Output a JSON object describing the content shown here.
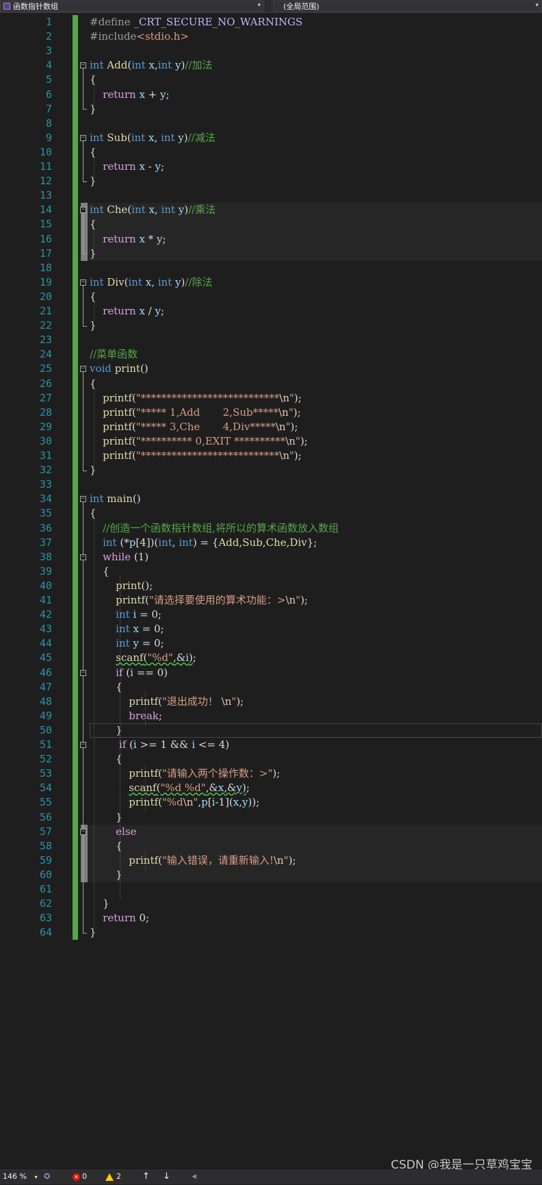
{
  "navbar": {
    "file_scope": "函数指针数组",
    "member_scope": "(全局范围)"
  },
  "colors": {
    "background": "#1e1e1e",
    "line_number": "#2b91af",
    "keyword": "#569cd6",
    "control_keyword": "#d8a0df",
    "string": "#d69d85",
    "comment": "#57a64a",
    "function": "#dcdcaa",
    "change_bar": "#57a64a"
  },
  "editor": {
    "line_numbers": [
      "1",
      "2",
      "3",
      "4",
      "5",
      "6",
      "7",
      "8",
      "9",
      "10",
      "11",
      "12",
      "13",
      "14",
      "15",
      "16",
      "17",
      "18",
      "19",
      "20",
      "21",
      "22",
      "23",
      "24",
      "25",
      "26",
      "27",
      "28",
      "29",
      "30",
      "31",
      "32",
      "33",
      "34",
      "35",
      "36",
      "37",
      "38",
      "39",
      "40",
      "41",
      "42",
      "43",
      "44",
      "45",
      "46",
      "47",
      "48",
      "49",
      "50",
      "51",
      "52",
      "53",
      "54",
      "55",
      "56",
      "57",
      "58",
      "59",
      "60",
      "61",
      "62",
      "63",
      "64"
    ],
    "tokens": {
      "define": "#define",
      "crt_macro": "_CRT_SECURE_NO_WARNINGS",
      "include": "#include",
      "stdio": "<stdio.h>",
      "int": "int",
      "void": "void",
      "return": "return",
      "while": "while",
      "if": "if",
      "else": "else",
      "break": "break",
      "add": "Add",
      "sub": "Sub",
      "che": "Che",
      "div": "Div",
      "print": "print",
      "main": "main",
      "printf": "printf",
      "scanf": "scanf",
      "x": "x",
      "y": "y",
      "i": "i",
      "p": "p"
    },
    "comments": {
      "add": "//加法",
      "sub": "//减法",
      "che": "//乘法",
      "div": "//除法",
      "menu": "//菜单函数",
      "create": "//创造一个函数指针数组,将所以的算术函数放入数组"
    },
    "strings": {
      "stars": "\"***************************",
      "menu1": "\"***** 1,Add       2,Sub*****",
      "menu2": "\"***** 3,Che       4,Div*****",
      "menu3": "\"********** 0,EXIT **********",
      "choose": "\"请选择要使用的算术功能：>",
      "fmt_d": "\"%d\"",
      "exit_ok": "\"退出成功！ ",
      "input_two": "\"请输入两个操作数：>\"",
      "fmt_dd": "\"%d %d\"",
      "fmt_dn": "\"%d",
      "input_err": "\"输入错误，请重新输入!"
    },
    "escape_n": "\\n",
    "quote": "\""
  },
  "statusbar": {
    "zoom": "146 %",
    "errors": "0",
    "warnings": "2"
  },
  "watermark": "CSDN @我是一只草鸡宝宝"
}
